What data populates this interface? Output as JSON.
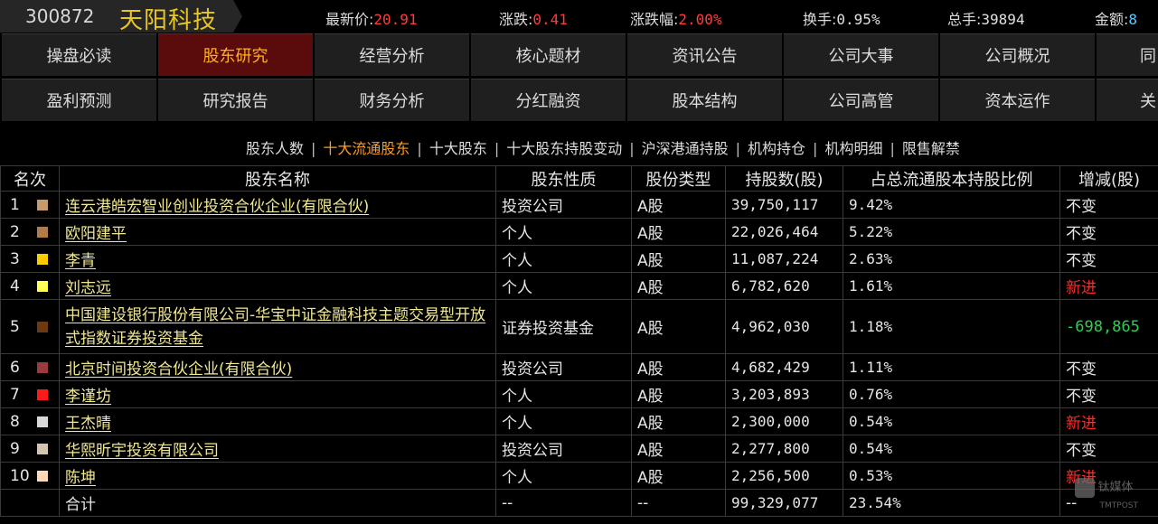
{
  "header": {
    "code": "300872",
    "name": "天阳科技",
    "quotes": [
      {
        "label": "最新价:",
        "value": "20.91",
        "color": "red"
      },
      {
        "label": "涨跌:",
        "value": "0.41",
        "color": "red"
      },
      {
        "label": "涨跌幅:",
        "value": "2.00%",
        "color": "red"
      },
      {
        "label": "换手:",
        "value": "0.95%",
        "color": "wht"
      },
      {
        "label": "总手:",
        "value": "39894",
        "color": "wht"
      },
      {
        "label": "金额:",
        "value": "8",
        "color": "cyn"
      }
    ]
  },
  "nav": {
    "row1": [
      "操盘必读",
      "股东研究",
      "经营分析",
      "核心题材",
      "资讯公告",
      "公司大事",
      "公司概况",
      "同"
    ],
    "row2": [
      "盈利预测",
      "研究报告",
      "财务分析",
      "分红融资",
      "股本结构",
      "公司高管",
      "资本运作",
      "关"
    ],
    "active": "股东研究"
  },
  "subnav": {
    "items": [
      "股东人数",
      "十大流通股东",
      "十大股东",
      "十大股东持股变动",
      "沪深港通持股",
      "机构持仓",
      "机构明细",
      "限售解禁"
    ],
    "active": "十大流通股东",
    "separator": "|"
  },
  "table": {
    "headers": [
      "名次",
      "股东名称",
      "股东性质",
      "股份类型",
      "持股数(股)",
      "占总流通股本持股比例",
      "增减(股)"
    ],
    "rows": [
      {
        "rank": "1",
        "swatch": "#c89a6a",
        "name": "连云港皓宏智业创业投资合伙企业(有限合伙)",
        "nature": "投资公司",
        "type": "A股",
        "shares": "39,750,117",
        "ratio": "9.42%",
        "change": "不变",
        "kind": "same"
      },
      {
        "rank": "2",
        "swatch": "#b07c4a",
        "name": "欧阳建平",
        "nature": "个人",
        "type": "A股",
        "shares": "22,026,464",
        "ratio": "5.22%",
        "change": "不变",
        "kind": "same"
      },
      {
        "rank": "3",
        "swatch": "#ffcc00",
        "name": "李青",
        "nature": "个人",
        "type": "A股",
        "shares": "11,087,224",
        "ratio": "2.63%",
        "change": "不变",
        "kind": "same"
      },
      {
        "rank": "4",
        "swatch": "#ffff55",
        "name": "刘志远",
        "nature": "个人",
        "type": "A股",
        "shares": "6,782,620",
        "ratio": "1.61%",
        "change": "新进",
        "kind": "new"
      },
      {
        "rank": "5",
        "swatch": "#6a3a12",
        "name": "中国建设银行股份有限公司-华宝中证金融科技主题交易型开放式指数证券投资基金",
        "nature": "证券投资基金",
        "type": "A股",
        "shares": "4,962,030",
        "ratio": "1.18%",
        "change": "-698,865",
        "kind": "down"
      },
      {
        "rank": "6",
        "swatch": "#9a3a3a",
        "name": "北京时间投资合伙企业(有限合伙)",
        "nature": "投资公司",
        "type": "A股",
        "shares": "4,682,429",
        "ratio": "1.11%",
        "change": "不变",
        "kind": "same"
      },
      {
        "rank": "7",
        "swatch": "#ff1a1a",
        "name": "李谨坊",
        "nature": "个人",
        "type": "A股",
        "shares": "3,203,893",
        "ratio": "0.76%",
        "change": "不变",
        "kind": "same"
      },
      {
        "rank": "8",
        "swatch": "#d8d8d8",
        "name": "王杰晴",
        "nature": "个人",
        "type": "A股",
        "shares": "2,300,000",
        "ratio": "0.54%",
        "change": "新进",
        "kind": "new"
      },
      {
        "rank": "9",
        "swatch": "#d4c4b4",
        "name": "华熙昕宇投资有限公司",
        "nature": "投资公司",
        "type": "A股",
        "shares": "2,277,800",
        "ratio": "0.54%",
        "change": "不变",
        "kind": "same"
      },
      {
        "rank": "10",
        "swatch": "#ffd8b8",
        "name": "陈坤",
        "nature": "个人",
        "type": "A股",
        "shares": "2,256,500",
        "ratio": "0.53%",
        "change": "新进",
        "kind": "new"
      }
    ],
    "total": {
      "label": "合计",
      "nature": "--",
      "type": "--",
      "shares": "99,329,077",
      "ratio": "23.54%",
      "change": "--"
    }
  },
  "watermark": {
    "line1": "钛媒体",
    "line2": "TMTPOST"
  }
}
